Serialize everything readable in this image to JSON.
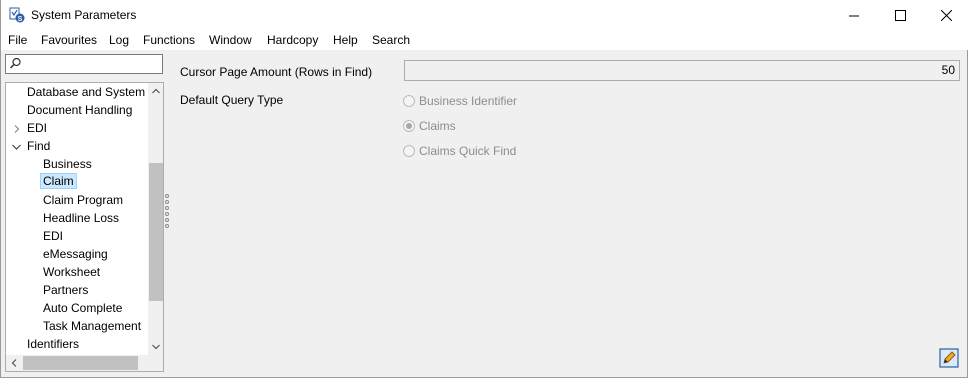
{
  "window": {
    "title": "System Parameters"
  },
  "menu": [
    "File",
    "Favourites",
    "Log",
    "Functions",
    "Window",
    "Hardcopy",
    "Help",
    "Search"
  ],
  "search": {
    "value": ""
  },
  "tree": {
    "items": [
      {
        "label": "Database and System",
        "level": 0
      },
      {
        "label": "Document Handling",
        "level": 0
      },
      {
        "label": "EDI",
        "level": 0,
        "expander": "collapsed"
      },
      {
        "label": "Find",
        "level": 0,
        "expander": "expanded"
      },
      {
        "label": "Business",
        "level": 1
      },
      {
        "label": "Claim",
        "level": 1,
        "selected": true
      },
      {
        "label": "Claim Program",
        "level": 1
      },
      {
        "label": "Headline Loss",
        "level": 1
      },
      {
        "label": "EDI",
        "level": 1
      },
      {
        "label": "eMessaging",
        "level": 1
      },
      {
        "label": "Worksheet",
        "level": 1
      },
      {
        "label": "Partners",
        "level": 1
      },
      {
        "label": "Auto Complete",
        "level": 1
      },
      {
        "label": "Task Management",
        "level": 1
      },
      {
        "label": "Identifiers",
        "level": 0
      }
    ]
  },
  "form": {
    "cursor_label": "Cursor Page Amount (Rows in Find)",
    "cursor_value": "50",
    "query_label": "Default Query Type",
    "query_options": [
      {
        "label": "Business Identifier",
        "checked": false
      },
      {
        "label": "Claims",
        "checked": true
      },
      {
        "label": "Claims Quick Find",
        "checked": false
      }
    ]
  }
}
